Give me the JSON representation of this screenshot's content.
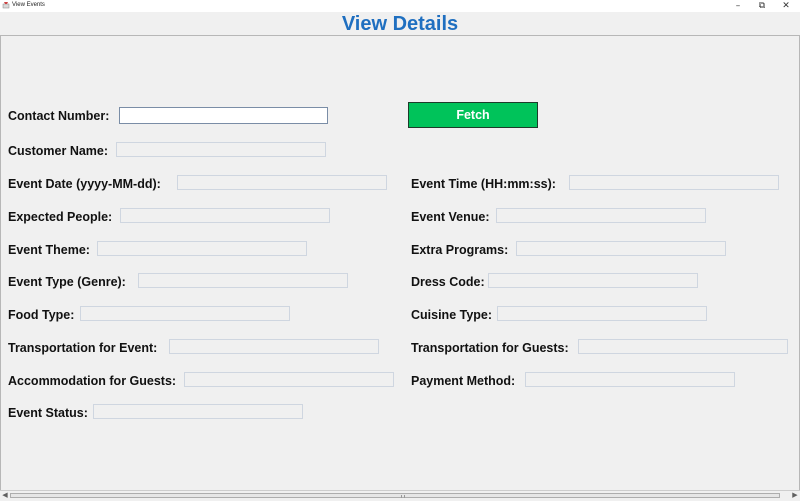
{
  "window": {
    "title": "View Events",
    "minimize_glyph": "–",
    "restore_glyph": "⧉",
    "close_glyph": "✕"
  },
  "heading": "View Details",
  "contact": {
    "label": "Contact Number:",
    "value": ""
  },
  "fetch_button": {
    "label": "Fetch",
    "color": "#00c35a"
  },
  "fields": {
    "customer_name": {
      "label": "Customer Name:",
      "value": ""
    },
    "event_date": {
      "label": "Event Date (yyyy-MM-dd):",
      "value": ""
    },
    "event_time": {
      "label": "Event Time (HH:mm:ss):",
      "value": ""
    },
    "expected_people": {
      "label": "Expected People:",
      "value": ""
    },
    "event_venue": {
      "label": "Event Venue:",
      "value": ""
    },
    "event_theme": {
      "label": "Event Theme:",
      "value": ""
    },
    "extra_programs": {
      "label": "Extra Programs:",
      "value": ""
    },
    "event_type": {
      "label": "Event Type (Genre):",
      "value": ""
    },
    "dress_code": {
      "label": "Dress Code:",
      "value": ""
    },
    "food_type": {
      "label": "Food Type:",
      "value": ""
    },
    "cuisine_type": {
      "label": "Cuisine Type:",
      "value": ""
    },
    "transport_event": {
      "label": "Transportation for Event:",
      "value": ""
    },
    "transport_guests": {
      "label": "Transportation for Guests:",
      "value": ""
    },
    "accommodation": {
      "label": "Accommodation for Guests:",
      "value": ""
    },
    "payment_method": {
      "label": "Payment Method:",
      "value": ""
    },
    "event_status": {
      "label": "Event Status:",
      "value": ""
    }
  },
  "scrollbar": {
    "left_glyph": "◀",
    "right_glyph": "▶"
  },
  "colors": {
    "heading": "#1f6fc0",
    "background": "#f0f0f0"
  }
}
